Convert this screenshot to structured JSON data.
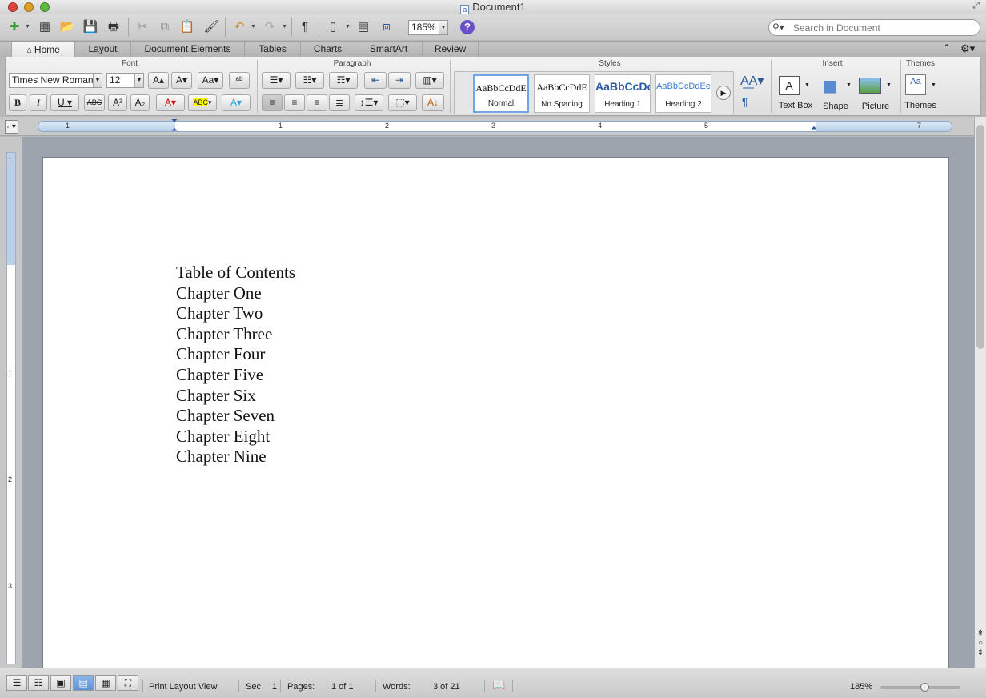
{
  "window": {
    "title": "Document1"
  },
  "toolbar": {
    "zoom": "185%",
    "search_placeholder": "Search in Document"
  },
  "tabs": [
    "Home",
    "Layout",
    "Document Elements",
    "Tables",
    "Charts",
    "SmartArt",
    "Review"
  ],
  "ribbon": {
    "groups": {
      "font": "Font",
      "paragraph": "Paragraph",
      "styles": "Styles",
      "insert": "Insert",
      "themes": "Themes"
    },
    "font_name": "Times New Roman",
    "font_size": "12",
    "styles": [
      {
        "preview": "AaBbCcDdE",
        "name": "Normal"
      },
      {
        "preview": "AaBbCcDdE",
        "name": "No Spacing"
      },
      {
        "preview": "AaBbCcDc",
        "name": "Heading 1"
      },
      {
        "preview": "AaBbCcDdEe",
        "name": "Heading 2"
      }
    ],
    "insert": {
      "textbox": "Text Box",
      "shape": "Shape",
      "picture": "Picture"
    },
    "themes_label": "Themes",
    "accent_color": "#2a5aa0"
  },
  "ruler": {
    "h_numbers": [
      "1",
      "1",
      "2",
      "3",
      "4",
      "5",
      "7"
    ],
    "v_numbers": [
      "1",
      "1",
      "2",
      "3"
    ]
  },
  "document": {
    "lines": [
      "Table of Contents",
      "Chapter One",
      "Chapter Two",
      "Chapter Three",
      "Chapter Four",
      "Chapter Five",
      "Chapter Six",
      "Chapter Seven",
      "Chapter Eight",
      "Chapter Nine"
    ]
  },
  "status": {
    "view": "Print Layout View",
    "sec_label": "Sec",
    "sec_value": "1",
    "pages_label": "Pages:",
    "pages_value": "1 of 1",
    "words_label": "Words:",
    "words_value": "3 of 21",
    "zoom": "185%",
    "zoom_fraction": 0.55
  }
}
